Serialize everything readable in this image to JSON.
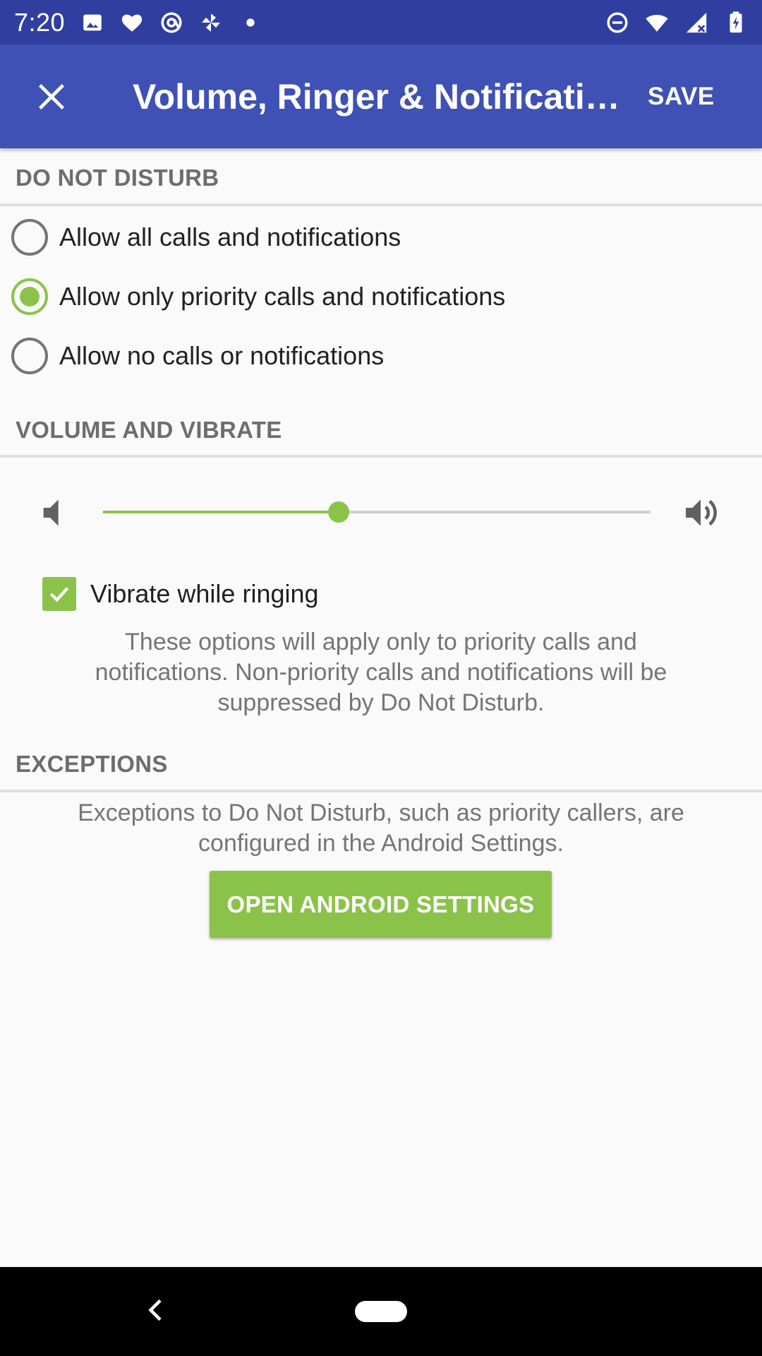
{
  "status_bar": {
    "time": "7:20",
    "left_icons": [
      "image-icon",
      "heart-icon",
      "at-sign-icon",
      "pinwheel-icon",
      "dot-icon"
    ],
    "right_icons": [
      "dnd-icon",
      "wifi-icon",
      "signal-icon",
      "battery-charging-icon"
    ]
  },
  "app_bar": {
    "title": "Volume, Ringer & Notifications",
    "save_label": "SAVE",
    "close_icon": "close-icon"
  },
  "do_not_disturb": {
    "header": "DO NOT DISTURB",
    "options": [
      {
        "label": "Allow all calls and notifications",
        "selected": false
      },
      {
        "label": "Allow only priority calls and notifications",
        "selected": true
      },
      {
        "label": "Allow no calls or notifications",
        "selected": false
      }
    ]
  },
  "volume": {
    "header": "VOLUME AND VIBRATE",
    "level": 0.43,
    "vibrate_label": "Vibrate while ringing",
    "vibrate_checked": true,
    "note": "These options will apply only to priority calls and notifications. Non-priority calls and notifications will be suppressed by Do Not Disturb."
  },
  "exceptions": {
    "header": "EXCEPTIONS",
    "note": "Exceptions to Do Not Disturb, such as priority callers, are configured in the Android Settings.",
    "button_label": "OPEN ANDROID SETTINGS"
  },
  "colors": {
    "status_bar": "#303f9f",
    "app_bar": "#3f51b5",
    "accent": "#8bc34a"
  }
}
